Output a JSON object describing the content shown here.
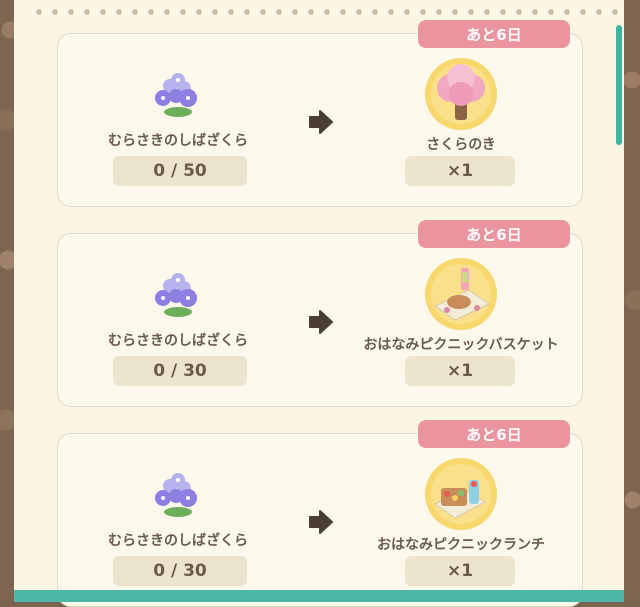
{
  "trades": [
    {
      "days_left": "あと6日",
      "material": "むらさきのしばざくら",
      "progress": "0 / 50",
      "reward": "さくらのき",
      "reward_qty": "×1",
      "reward_icon": "cherry-tree-icon"
    },
    {
      "days_left": "あと6日",
      "material": "むらさきのしばざくら",
      "progress": "0 / 30",
      "reward": "おはなみピクニックバスケット",
      "reward_qty": "×1",
      "reward_icon": "picnic-basket-icon"
    },
    {
      "days_left": "あと6日",
      "material": "むらさきのしばざくら",
      "progress": "0 / 30",
      "reward": "おはなみピクニックランチ",
      "reward_qty": "×1",
      "reward_icon": "picnic-lunch-icon"
    }
  ],
  "colors": {
    "badge": "#e9949f",
    "panel": "#fbf5e6",
    "accent": "#4db8a6"
  }
}
